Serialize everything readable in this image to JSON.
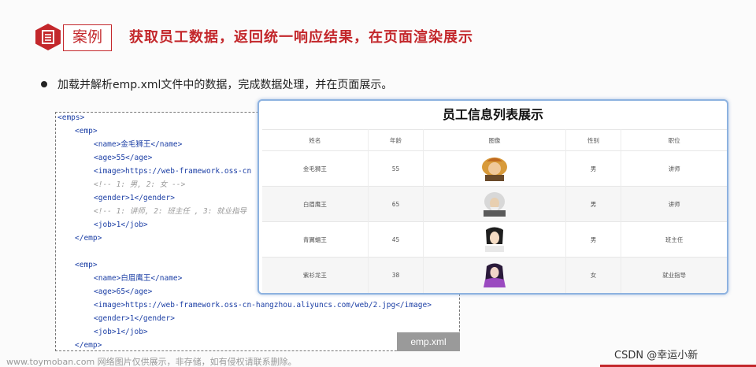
{
  "header": {
    "tag": "案例",
    "title": "获取员工数据，返回统一响应结果，在页面渲染展示"
  },
  "bullet": "加载并解析emp.xml文件中的数据，完成数据处理，并在页面展示。",
  "code": {
    "file_label": "emp.xml",
    "lines": [
      "<emps>",
      "<emp>",
      "<name>金毛狮王</name>",
      "<age>55</age>",
      "<image>https://web-framework.oss-cn",
      "<!-- 1: 男, 2: 女 -->",
      "<gender>1</gender>",
      "<!-- 1: 讲师, 2: 班主任 , 3: 就业指导",
      "<job>1</job>",
      "</emp>",
      "<emp>",
      "<name>白眉鹰王</name>",
      "<age>65</age>",
      "<image>https://web-framework.oss-cn-hangzhou.aliyuncs.com/web/2.jpg</image>",
      "<gender>1</gender>",
      "<job>1</job>",
      "</emp>"
    ]
  },
  "panel": {
    "title": "员工信息列表展示",
    "columns": [
      "姓名",
      "年龄",
      "图像",
      "性别",
      "职位"
    ],
    "rows": [
      {
        "name": "金毛狮王",
        "age": "55",
        "avatar_icon": "portrait-golden-lion-icon",
        "gender": "男",
        "job": "讲师"
      },
      {
        "name": "白眉鹰王",
        "age": "65",
        "avatar_icon": "portrait-white-eagle-icon",
        "gender": "男",
        "job": "讲师"
      },
      {
        "name": "青翼蝠王",
        "age": "45",
        "avatar_icon": "portrait-green-bat-icon",
        "gender": "男",
        "job": "班主任"
      },
      {
        "name": "紫衫龙王",
        "age": "38",
        "avatar_icon": "portrait-purple-dragon-icon",
        "gender": "女",
        "job": "就业指导"
      }
    ]
  },
  "footer": {
    "watermark": "www.toymoban.com 网络图片仅供展示，非存储，如有侵权请联系删除。",
    "csdn": "CSDN @幸运小新"
  },
  "colors": {
    "accent": "#c3272b",
    "panel_border": "#8db2e0",
    "xml_tag": "#1c3fa5"
  }
}
